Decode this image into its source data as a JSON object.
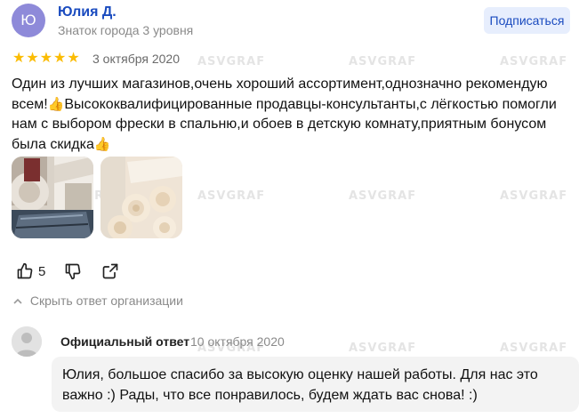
{
  "review": {
    "avatar_letter": "Ю",
    "author_name": "Юлия Д.",
    "author_level": "Знаток города 3 уровня",
    "subscribe_label": "Подписаться",
    "rating": 5,
    "date": "3 октября 2020",
    "text_part1": "Один из лучших магазинов,очень хороший ассортимент,однозначно рекомендую всем!",
    "text_part2": "Высококвалифицированные продавцы-консультанты,с лёгкостью помогли нам с выбором фрески в спальню,и обоев в детскую комнату,приятным бонусом была скидка",
    "thumbs_emoji": "👍",
    "like_count": "5",
    "hide_reply_label": "Скрыть ответ организации",
    "icons": [
      "thumbs-up-icon",
      "thumbs-down-icon",
      "share-icon",
      "chevron-up-icon",
      "star-icon"
    ]
  },
  "reply": {
    "title": "Официальный ответ",
    "date": "10 октября 2020",
    "text": "Юлия, большое спасибо за высокую оценку нашей работы. Для нас это важно :) Рады, что все понравилось, будем ждать вас снова! :)"
  },
  "watermark": "ASVGRAF",
  "colors": {
    "link_blue": "#1a4bbf",
    "star_yellow": "#fbbc04",
    "avatar_purple": "#8e8ad9",
    "subscribe_bg": "#e7eefd",
    "reply_bg": "#f3f3f3",
    "muted_text": "#8a8a8a"
  }
}
